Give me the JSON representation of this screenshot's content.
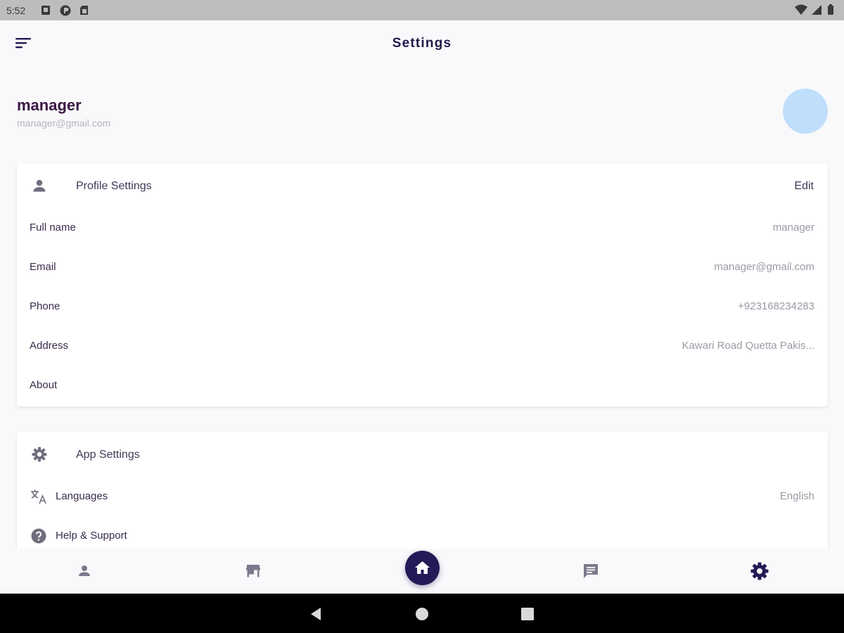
{
  "status_bar": {
    "time": "5:52"
  },
  "app_bar": {
    "title": "Settings"
  },
  "profile": {
    "name": "manager",
    "email": "manager@gmail.com"
  },
  "profile_settings": {
    "title": "Profile Settings",
    "edit_label": "Edit",
    "rows": [
      {
        "label": "Full name",
        "value": "manager"
      },
      {
        "label": "Email",
        "value": "manager@gmail.com"
      },
      {
        "label": "Phone",
        "value": "+923168234283"
      },
      {
        "label": "Address",
        "value": "Kawari Road Quetta Pakis..."
      },
      {
        "label": "About",
        "value": ""
      }
    ]
  },
  "app_settings": {
    "title": "App Settings",
    "rows": [
      {
        "label": "Languages",
        "value": "English",
        "icon": "translate-icon"
      },
      {
        "label": "Help & Support",
        "value": "",
        "icon": "help-icon"
      }
    ]
  },
  "bottom_nav": {
    "items": [
      "person-icon",
      "store-icon",
      "home-icon",
      "chat-icon",
      "settings-icon"
    ],
    "active": "settings-icon"
  },
  "colors": {
    "primary": "#231b57",
    "name_text": "#3b1743",
    "avatar": "#bfdefb",
    "muted_text": "#9a9aa6"
  }
}
